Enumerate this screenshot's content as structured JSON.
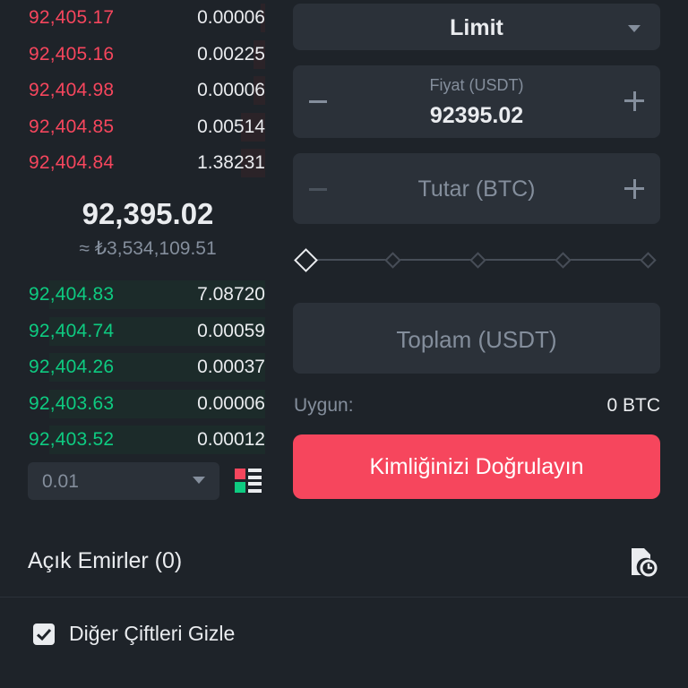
{
  "orderbook": {
    "asks": [
      {
        "price": "92,405.17",
        "qty": "0.00006",
        "depth": 0.02
      },
      {
        "price": "92,405.16",
        "qty": "0.00225",
        "depth": 0.05
      },
      {
        "price": "92,404.98",
        "qty": "0.00006",
        "depth": 0.05
      },
      {
        "price": "92,404.85",
        "qty": "0.00514",
        "depth": 0.1
      },
      {
        "price": "92,404.84",
        "qty": "1.38231",
        "depth": 0.1
      }
    ],
    "mid_price": "92,395.02",
    "mid_fiat": "≈ ₺3,534,109.51",
    "bids": [
      {
        "price": "92,404.83",
        "qty": "7.08720",
        "depth": 0.9
      },
      {
        "price": "92,404.74",
        "qty": "0.00059",
        "depth": 0.9
      },
      {
        "price": "92,404.26",
        "qty": "0.00037",
        "depth": 0.9
      },
      {
        "price": "92,403.63",
        "qty": "0.00006",
        "depth": 0.9
      },
      {
        "price": "92,403.52",
        "qty": "0.00012",
        "depth": 0.9
      }
    ],
    "step": "0.01"
  },
  "form": {
    "order_type": "Limit",
    "price_label": "Fiyat (USDT)",
    "price_value": "92395.02",
    "amount_placeholder": "Tutar (BTC)",
    "total_placeholder": "Toplam (USDT)",
    "slider_percent": 0,
    "available_label": "Uygun:",
    "available_value": "0 BTC",
    "submit_label": "Kimliğinizi Doğrulayın"
  },
  "orders": {
    "title": "Açık Emirler (0)",
    "hide_pairs_label": "Diğer Çiftleri Gizle",
    "hide_pairs_checked": true
  },
  "colors": {
    "ask": "#f6465d",
    "bid": "#0ecb81",
    "background": "#1e2329",
    "panel": "#2b3139",
    "button": "#f6465d"
  },
  "icons": [
    "chevron-down-icon",
    "minus-icon",
    "plus-icon",
    "orderbook-layout-icon",
    "order-history-icon",
    "checkbox-checked-icon"
  ]
}
